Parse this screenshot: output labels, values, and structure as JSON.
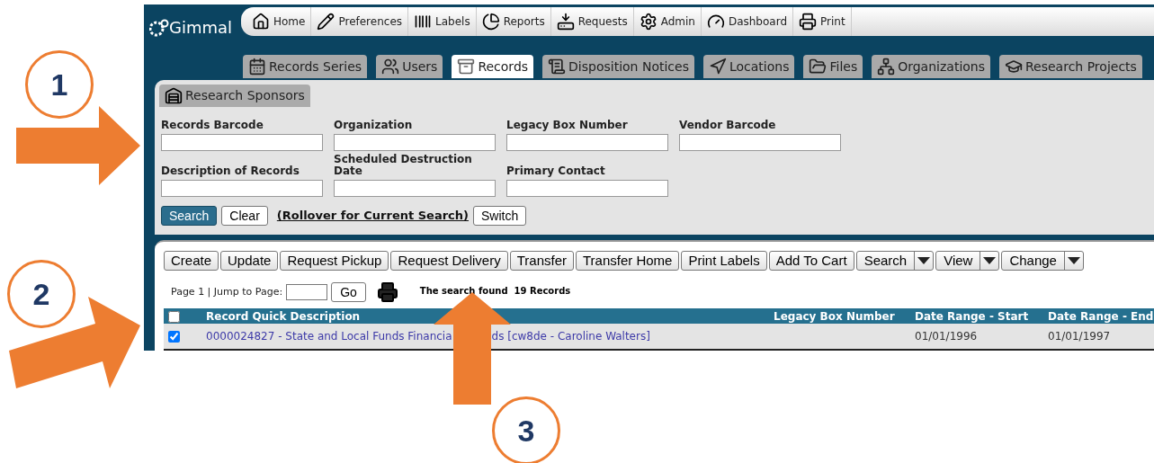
{
  "logo": "Gimmal",
  "top_nav": [
    {
      "label": "Home",
      "kind": "home"
    },
    {
      "label": "Preferences",
      "kind": "pencil"
    },
    {
      "label": "Labels",
      "kind": "barcode"
    },
    {
      "label": "Reports",
      "kind": "pie"
    },
    {
      "label": "Requests",
      "kind": "inbox"
    },
    {
      "label": "Admin",
      "kind": "gear"
    },
    {
      "label": "Dashboard",
      "kind": "gauge"
    },
    {
      "label": "Print",
      "kind": "printer"
    }
  ],
  "tabs": [
    {
      "label": "Records Series",
      "kind": "calendar",
      "selected": false
    },
    {
      "label": "Users",
      "kind": "users",
      "selected": false
    },
    {
      "label": "Records",
      "kind": "box",
      "selected": true
    },
    {
      "label": "Disposition Notices",
      "kind": "scroll",
      "selected": false
    },
    {
      "label": "Locations",
      "kind": "navigation",
      "selected": false
    },
    {
      "label": "Files",
      "kind": "folder",
      "selected": false
    },
    {
      "label": "Organizations",
      "kind": "network",
      "selected": false
    },
    {
      "label": "Research Projects",
      "kind": "cap",
      "selected": false
    }
  ],
  "subtabs": [
    {
      "label": "Research Sponsors",
      "kind": "warehouse",
      "selected": true
    }
  ],
  "search_form": {
    "fields": [
      {
        "label": "Records Barcode"
      },
      {
        "label": "Organization"
      },
      {
        "label": "Legacy Box Number"
      },
      {
        "label": "Vendor Barcode"
      },
      {
        "label": "Description of Records"
      },
      {
        "label": "Scheduled Destruction Date"
      },
      {
        "label": "Primary Contact"
      }
    ],
    "search_button": "Search",
    "clear_button": "Clear",
    "rollover_link": "(Rollover for Current Search)",
    "switch_button": "Switch"
  },
  "toolbar": [
    {
      "label": "Create",
      "kind": "button"
    },
    {
      "label": "Update",
      "kind": "button"
    },
    {
      "label": "Request Pickup",
      "kind": "button"
    },
    {
      "label": "Request Delivery",
      "kind": "button"
    },
    {
      "label": "Transfer",
      "kind": "button"
    },
    {
      "label": "Transfer Home",
      "kind": "button"
    },
    {
      "label": "Print Labels",
      "kind": "button"
    },
    {
      "label": "Add To Cart",
      "kind": "button"
    },
    {
      "label": "Search",
      "kind": "dropdown"
    },
    {
      "label": "View",
      "kind": "dropdown"
    },
    {
      "label": "Change",
      "kind": "dropdown"
    }
  ],
  "pager": {
    "label": "Page 1 | Jump to Page:",
    "go_button": "Go",
    "result": "The search found  19 Records"
  },
  "table": {
    "select_all": {
      "checked": false
    },
    "columns": [
      "Record Quick Description",
      "Legacy Box Number",
      "Date Range - Start",
      "Date Range - End"
    ],
    "rows": [
      {
        "checked": true,
        "description_parts": [
          "0000024827 - State and Local Funds Financia",
          "ds [cw8de - Caroline Walters]"
        ],
        "date_start": "01/01/1996",
        "date_end": "01/01/1997"
      }
    ]
  },
  "callouts": [
    {
      "label": "1"
    },
    {
      "label": "2"
    },
    {
      "label": "3"
    }
  ]
}
